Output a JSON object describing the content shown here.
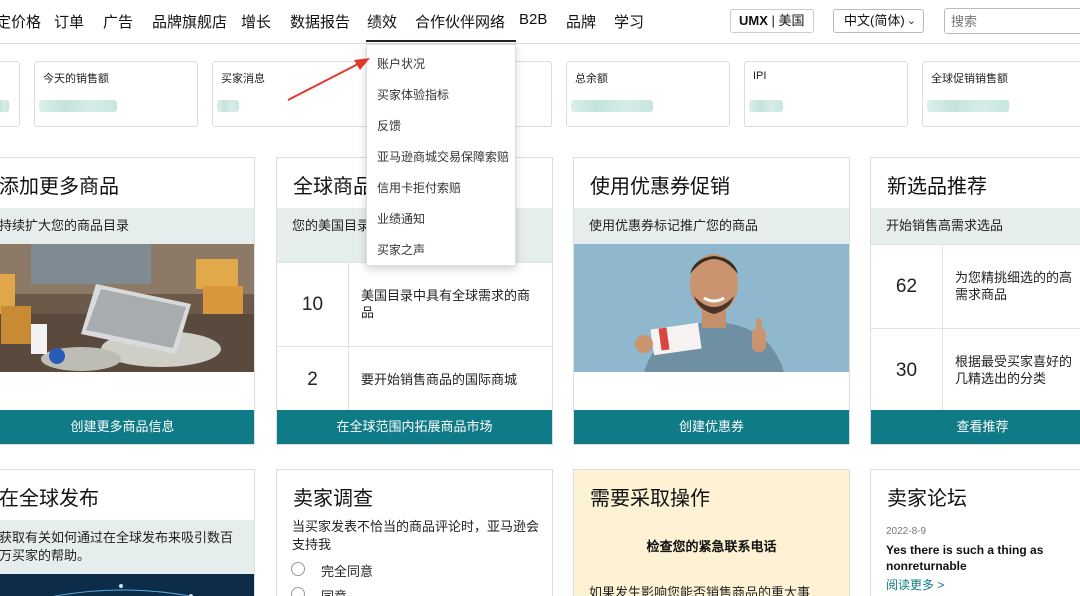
{
  "nav": {
    "items": [
      "定价格",
      "订单",
      "广告",
      "品牌旗舰店",
      "增长",
      "数据报告",
      "绩效",
      "合作伙伴网络",
      "B2B",
      "品牌",
      "学习"
    ],
    "marketplace_brand": "UMX",
    "marketplace_sep": " | ",
    "marketplace_region": "美国",
    "language": "中文(简体)",
    "search_placeholder": "搜索"
  },
  "dropdown": {
    "items": [
      "账户状况",
      "买家体验指标",
      "反馈",
      "亚马逊商城交易保障索赔",
      "信用卡拒付索赔",
      "业绩通知",
      "买家之声"
    ]
  },
  "metrics": [
    {
      "label": ""
    },
    {
      "label": "今天的销售额"
    },
    {
      "label": "买家消息"
    },
    {
      "label": ""
    },
    {
      "label": "总余额"
    },
    {
      "label": "IPI"
    },
    {
      "label": "全球促销销售额"
    }
  ],
  "cards": {
    "add_products": {
      "title": "添加更多商品",
      "subtitle": "持续扩大您的商品目录",
      "button": "创建更多商品信息"
    },
    "global_products": {
      "title": "全球商品",
      "subtitle": "您的美国目录中具有全球需求",
      "rows": [
        {
          "num": "10",
          "text": "美国目录中具有全球需求的商品"
        },
        {
          "num": "2",
          "text": "要开始销售商品的国际商城"
        }
      ],
      "button": "在全球范围内拓展商品市场"
    },
    "coupons": {
      "title": "使用优惠券促销",
      "subtitle": "使用优惠券标记推广您的商品",
      "button": "创建优惠券"
    },
    "new_selection": {
      "title": "新选品推荐",
      "subtitle": "开始销售高需求选品",
      "rows": [
        {
          "num": "62",
          "text": "为您精挑细选的的高需求商品"
        },
        {
          "num": "30",
          "text": "根据最受买家喜好的几精选出的分类"
        }
      ],
      "button": "查看推荐"
    },
    "global_publish": {
      "title": "在全球发布",
      "subtitle": "获取有关如何通过在全球发布来吸引数百万买家的帮助。"
    },
    "seller_survey": {
      "title": "卖家调查",
      "question": "当买家发表不恰当的商品评论时，亚马逊会支持我",
      "options": [
        "完全同意",
        "同意"
      ]
    },
    "action_needed": {
      "title": "需要采取操作",
      "heading": "检查您的紧急联系电话",
      "body": "如果发生影响您能否销售商品的重大事"
    },
    "forum": {
      "title": "卖家论坛",
      "date": "2022-8-9",
      "post": "Yes there is such a thing as nonreturnable",
      "link": "阅读更多 >"
    }
  },
  "colors": {
    "accent": "#0f7b86",
    "arrow": "#e0392b",
    "action_bg": "#fdf3d4"
  }
}
